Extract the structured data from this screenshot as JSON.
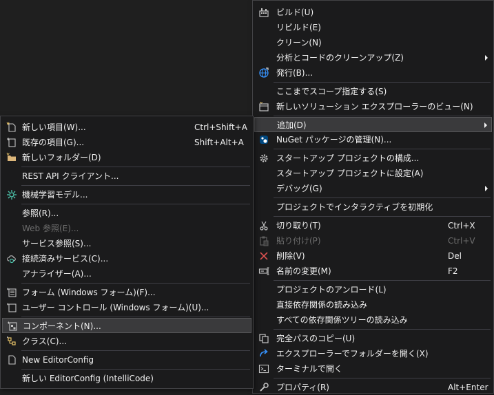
{
  "main_menu": {
    "build": "ビルド(U)",
    "rebuild": "リビルド(E)",
    "clean": "クリーン(N)",
    "analyze_cleanup": "分析とコードのクリーンアップ(Z)",
    "publish": "発行(B)...",
    "scope_to_this": "ここまでスコープ指定する(S)",
    "new_solution_explorer_view": "新しいソリューション エクスプローラーのビュー(N)",
    "add": "追加(D)",
    "manage_nuget": "NuGet パッケージの管理(N)...",
    "configure_startup": "スタートアップ プロジェクトの構成...",
    "set_startup": "スタートアップ プロジェクトに設定(A)",
    "debug": "デバッグ(G)",
    "init_interactive": "プロジェクトでインタラクティブを初期化",
    "cut": "切り取り(T)",
    "cut_shortcut": "Ctrl+X",
    "paste": "貼り付け(P)",
    "paste_shortcut": "Ctrl+V",
    "delete": "削除(V)",
    "delete_shortcut": "Del",
    "rename": "名前の変更(M)",
    "rename_shortcut": "F2",
    "unload_project": "プロジェクトのアンロード(L)",
    "load_direct_deps": "直接依存関係の読み込み",
    "load_all_deps": "すべての依存関係ツリーの読み込み",
    "copy_full_path": "完全パスのコピー(U)",
    "open_in_explorer": "エクスプローラーでフォルダーを開く(X)",
    "open_in_terminal": "ターミナルで開く",
    "properties": "プロパティ(R)",
    "properties_shortcut": "Alt+Enter"
  },
  "sub_menu": {
    "new_item": "新しい項目(W)...",
    "new_item_shortcut": "Ctrl+Shift+A",
    "existing_item": "既存の項目(G)...",
    "existing_item_shortcut": "Shift+Alt+A",
    "new_folder": "新しいフォルダー(D)",
    "rest_api_client": "REST API クライアント...",
    "ml_model": "機械学習モデル...",
    "reference": "参照(R)...",
    "web_reference": "Web 参照(E)...",
    "service_reference": "サービス参照(S)...",
    "connected_service": "接続済みサービス(C)...",
    "analyzer": "アナライザー(A)...",
    "windows_form": "フォーム (Windows フォーム)(F)...",
    "user_control": "ユーザー コントロール (Windows フォーム)(U)...",
    "component": "コンポーネント(N)...",
    "class": "クラス(C)...",
    "new_editorconfig": "New EditorConfig",
    "new_editorconfig_intellicode": "新しい EditorConfig (IntelliCode)"
  }
}
